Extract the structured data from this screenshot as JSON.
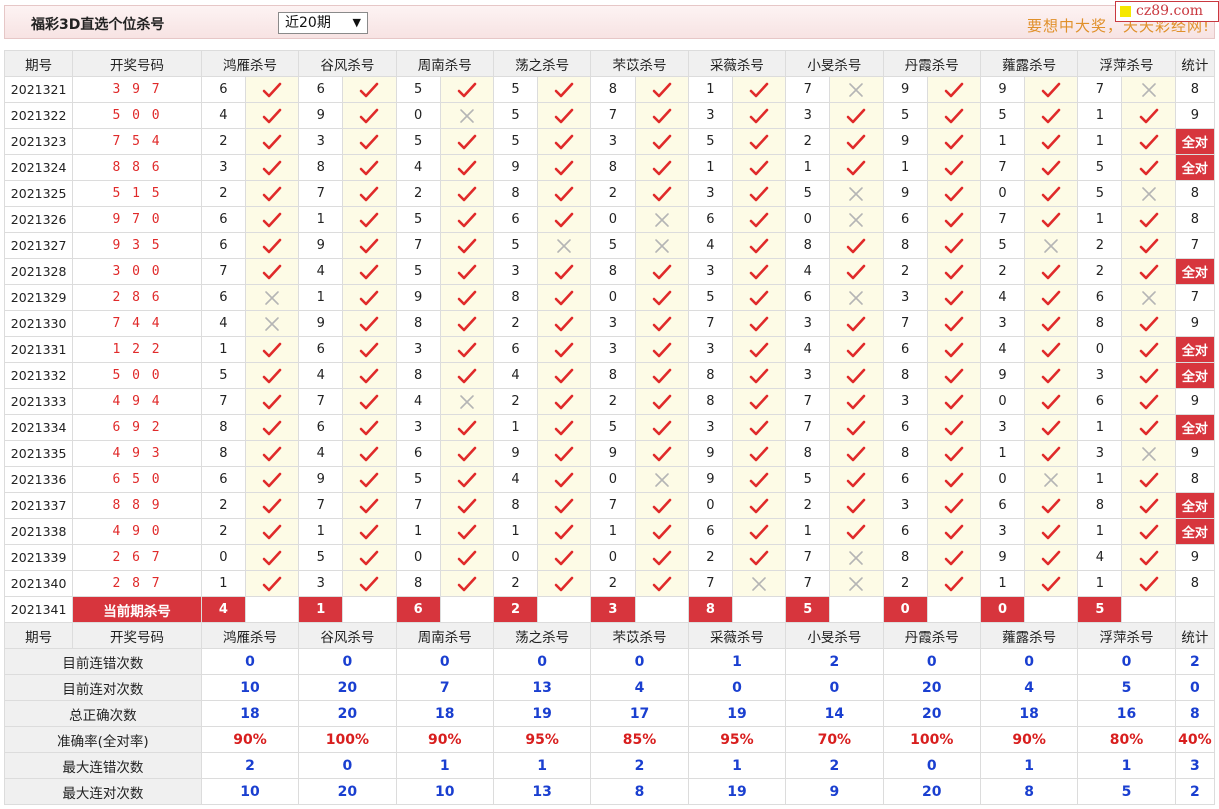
{
  "header": {
    "title": "福彩3D直选个位杀号",
    "range": "近20期",
    "slogan": "要想中大奖，天天彩经网!",
    "site": "cz89.com"
  },
  "columns": {
    "issue": "期号",
    "draw": "开奖号码",
    "experts": [
      "鸿雁杀号",
      "谷风杀号",
      "周南杀号",
      "荡之杀号",
      "芣苡杀号",
      "采薇杀号",
      "小旻杀号",
      "丹霞杀号",
      "蕹露杀号",
      "浮萍杀号"
    ],
    "total": "统计"
  },
  "rows": [
    {
      "issue": "2021321",
      "draw": "3 9 7",
      "kills": [
        6,
        6,
        5,
        5,
        8,
        1,
        7,
        9,
        9,
        7
      ],
      "ok": [
        1,
        1,
        1,
        1,
        1,
        1,
        0,
        1,
        1,
        0
      ],
      "total": "8"
    },
    {
      "issue": "2021322",
      "draw": "5 0 0",
      "kills": [
        4,
        9,
        0,
        5,
        7,
        3,
        3,
        5,
        5,
        1
      ],
      "ok": [
        1,
        1,
        0,
        1,
        1,
        1,
        1,
        1,
        1,
        1
      ],
      "total": "9"
    },
    {
      "issue": "2021323",
      "draw": "7 5 4",
      "kills": [
        2,
        3,
        5,
        5,
        3,
        5,
        2,
        9,
        1,
        1
      ],
      "ok": [
        1,
        1,
        1,
        1,
        1,
        1,
        1,
        1,
        1,
        1
      ],
      "total": "全对"
    },
    {
      "issue": "2021324",
      "draw": "8 8 6",
      "kills": [
        3,
        8,
        4,
        9,
        8,
        1,
        1,
        1,
        7,
        5
      ],
      "ok": [
        1,
        1,
        1,
        1,
        1,
        1,
        1,
        1,
        1,
        1
      ],
      "total": "全对"
    },
    {
      "issue": "2021325",
      "draw": "5 1 5",
      "kills": [
        2,
        7,
        2,
        8,
        2,
        3,
        5,
        9,
        0,
        5
      ],
      "ok": [
        1,
        1,
        1,
        1,
        1,
        1,
        0,
        1,
        1,
        0
      ],
      "total": "8"
    },
    {
      "issue": "2021326",
      "draw": "9 7 0",
      "kills": [
        6,
        1,
        5,
        6,
        0,
        6,
        0,
        6,
        7,
        1
      ],
      "ok": [
        1,
        1,
        1,
        1,
        0,
        1,
        0,
        1,
        1,
        1
      ],
      "total": "8"
    },
    {
      "issue": "2021327",
      "draw": "9 3 5",
      "kills": [
        6,
        9,
        7,
        5,
        5,
        4,
        8,
        8,
        5,
        2
      ],
      "ok": [
        1,
        1,
        1,
        0,
        0,
        1,
        1,
        1,
        0,
        1
      ],
      "total": "7"
    },
    {
      "issue": "2021328",
      "draw": "3 0 0",
      "kills": [
        7,
        4,
        5,
        3,
        8,
        3,
        4,
        2,
        2,
        2
      ],
      "ok": [
        1,
        1,
        1,
        1,
        1,
        1,
        1,
        1,
        1,
        1
      ],
      "total": "全对"
    },
    {
      "issue": "2021329",
      "draw": "2 8 6",
      "kills": [
        6,
        1,
        9,
        8,
        0,
        5,
        6,
        3,
        4,
        6
      ],
      "ok": [
        0,
        1,
        1,
        1,
        1,
        1,
        0,
        1,
        1,
        0
      ],
      "total": "7"
    },
    {
      "issue": "2021330",
      "draw": "7 4 4",
      "kills": [
        4,
        9,
        8,
        2,
        3,
        7,
        3,
        7,
        3,
        8
      ],
      "ok": [
        0,
        1,
        1,
        1,
        1,
        1,
        1,
        1,
        1,
        1
      ],
      "total": "9"
    },
    {
      "issue": "2021331",
      "draw": "1 2 2",
      "kills": [
        1,
        6,
        3,
        6,
        3,
        3,
        4,
        6,
        4,
        0
      ],
      "ok": [
        1,
        1,
        1,
        1,
        1,
        1,
        1,
        1,
        1,
        1
      ],
      "total": "全对"
    },
    {
      "issue": "2021332",
      "draw": "5 0 0",
      "kills": [
        5,
        4,
        8,
        4,
        8,
        8,
        3,
        8,
        9,
        3
      ],
      "ok": [
        1,
        1,
        1,
        1,
        1,
        1,
        1,
        1,
        1,
        1
      ],
      "total": "全对"
    },
    {
      "issue": "2021333",
      "draw": "4 9 4",
      "kills": [
        7,
        7,
        4,
        2,
        2,
        8,
        7,
        3,
        0,
        6
      ],
      "ok": [
        1,
        1,
        0,
        1,
        1,
        1,
        1,
        1,
        1,
        1
      ],
      "total": "9"
    },
    {
      "issue": "2021334",
      "draw": "6 9 2",
      "kills": [
        8,
        6,
        3,
        1,
        5,
        3,
        7,
        6,
        3,
        1
      ],
      "ok": [
        1,
        1,
        1,
        1,
        1,
        1,
        1,
        1,
        1,
        1
      ],
      "total": "全对"
    },
    {
      "issue": "2021335",
      "draw": "4 9 3",
      "kills": [
        8,
        4,
        6,
        9,
        9,
        9,
        8,
        8,
        1,
        3
      ],
      "ok": [
        1,
        1,
        1,
        1,
        1,
        1,
        1,
        1,
        1,
        0
      ],
      "total": "9"
    },
    {
      "issue": "2021336",
      "draw": "6 5 0",
      "kills": [
        6,
        9,
        5,
        4,
        0,
        9,
        5,
        6,
        0,
        1
      ],
      "ok": [
        1,
        1,
        1,
        1,
        0,
        1,
        1,
        1,
        0,
        1
      ],
      "total": "8"
    },
    {
      "issue": "2021337",
      "draw": "8 8 9",
      "kills": [
        2,
        7,
        7,
        8,
        7,
        0,
        2,
        3,
        6,
        8
      ],
      "ok": [
        1,
        1,
        1,
        1,
        1,
        1,
        1,
        1,
        1,
        1
      ],
      "total": "全对"
    },
    {
      "issue": "2021338",
      "draw": "4 9 0",
      "kills": [
        2,
        1,
        1,
        1,
        1,
        6,
        1,
        6,
        3,
        1
      ],
      "ok": [
        1,
        1,
        1,
        1,
        1,
        1,
        1,
        1,
        1,
        1
      ],
      "total": "全对"
    },
    {
      "issue": "2021339",
      "draw": "2 6 7",
      "kills": [
        0,
        5,
        0,
        0,
        0,
        2,
        7,
        8,
        9,
        4
      ],
      "ok": [
        1,
        1,
        1,
        1,
        1,
        1,
        0,
        1,
        1,
        1
      ],
      "total": "9"
    },
    {
      "issue": "2021340",
      "draw": "2 8 7",
      "kills": [
        1,
        3,
        8,
        2,
        2,
        7,
        7,
        2,
        1,
        1
      ],
      "ok": [
        1,
        1,
        1,
        1,
        1,
        0,
        0,
        1,
        1,
        1
      ],
      "total": "8"
    }
  ],
  "current": {
    "issue": "2021341",
    "label": "当前期杀号",
    "kills": [
      "4",
      "1",
      "6",
      "2",
      "3",
      "8",
      "5",
      "0",
      "0",
      "5"
    ]
  },
  "stats": [
    {
      "label": "目前连错次数",
      "values": [
        "0",
        "0",
        "0",
        "0",
        "0",
        "1",
        "2",
        "0",
        "0",
        "0"
      ],
      "total": "2"
    },
    {
      "label": "目前连对次数",
      "values": [
        "10",
        "20",
        "7",
        "13",
        "4",
        "0",
        "0",
        "20",
        "4",
        "5"
      ],
      "total": "0"
    },
    {
      "label": "总正确次数",
      "values": [
        "18",
        "20",
        "18",
        "19",
        "17",
        "19",
        "14",
        "20",
        "18",
        "16"
      ],
      "total": "8"
    },
    {
      "label": "准确率(全对率)",
      "values": [
        "90%",
        "100%",
        "90%",
        "95%",
        "85%",
        "95%",
        "70%",
        "100%",
        "90%",
        "80%"
      ],
      "total": "40%",
      "pct": true
    },
    {
      "label": "最大连错次数",
      "values": [
        "2",
        "0",
        "1",
        "1",
        "2",
        "1",
        "2",
        "0",
        "1",
        "1"
      ],
      "total": "3"
    },
    {
      "label": "最大连对次数",
      "values": [
        "10",
        "20",
        "10",
        "13",
        "8",
        "19",
        "9",
        "20",
        "8",
        "5"
      ],
      "total": "2"
    }
  ],
  "colors": {
    "accent": "#d7353d",
    "check": "#e02a2a",
    "cross": "#b5b5b5",
    "stat_blue": "#1a3fd0"
  }
}
